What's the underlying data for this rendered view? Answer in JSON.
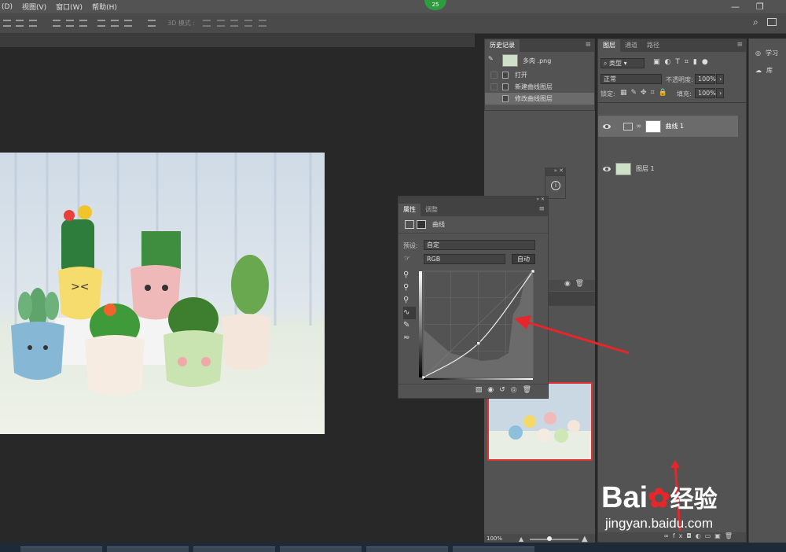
{
  "menu": {
    "items": [
      "(D)",
      "视图(V)",
      "窗口(W)",
      "帮助(H)"
    ]
  },
  "badge": "25",
  "options": {
    "mode_3d": "3D 模式 :"
  },
  "history": {
    "tab": "历史记录",
    "snapshot": "多肉 .png",
    "items": [
      "打开",
      "新建曲线图层",
      "修改曲线图层"
    ]
  },
  "layers": {
    "tabs": [
      "图层",
      "通道",
      "路径"
    ],
    "kind_filter": "类型",
    "blend_mode": "正常",
    "opacity_label": "不透明度:",
    "opacity_value": "100%",
    "lock_label": "锁定:",
    "fill_label": "填充:",
    "fill_value": "100%",
    "items": [
      {
        "name": "曲线 1",
        "type": "adjustment"
      },
      {
        "name": "图层 1",
        "type": "pixel"
      }
    ]
  },
  "right_tools": {
    "learn": "学习",
    "library": "库"
  },
  "properties": {
    "tabs": [
      "属性",
      "调整"
    ],
    "title": "曲线",
    "preset_label": "预设:",
    "preset_value": "自定",
    "channel": "RGB",
    "auto_button": "自动"
  },
  "curve": {
    "points": [
      [
        0,
        0
      ],
      [
        128,
        82
      ],
      [
        255,
        255
      ]
    ]
  },
  "navigator": {
    "zoom": "100%"
  },
  "watermark": {
    "brand": "Bai",
    "brand2": "经验",
    "url": "jingyan.baidu.com"
  },
  "colors": {
    "arrow": "#e8262a",
    "badge": "#2e9b3f",
    "ui_bg": "#535353"
  }
}
